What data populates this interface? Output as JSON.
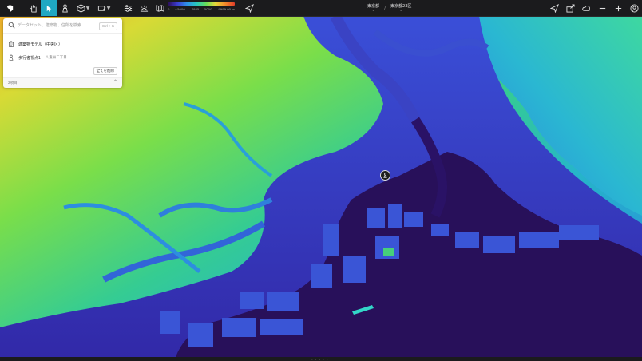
{
  "toolbar": {
    "tools": [
      {
        "name": "logo-icon"
      },
      {
        "name": "hand-icon"
      },
      {
        "name": "cursor-icon",
        "active": true
      },
      {
        "name": "pedestrian-icon"
      },
      {
        "name": "cube-icon"
      },
      {
        "name": "sketch-icon"
      },
      {
        "name": "sliders-icon"
      },
      {
        "name": "sun-icon"
      },
      {
        "name": "map-book-icon"
      }
    ],
    "accent": "#1fa8c2",
    "legend_ticks": [
      "0",
      "+5000",
      "-7935",
      "5000",
      "-9999.00 m"
    ]
  },
  "breadcrumb": {
    "items": [
      "東京都",
      "東京都23区"
    ],
    "separator": "/"
  },
  "right_tools": [
    "send-icon",
    "share-icon",
    "cloud-icon",
    "minus-icon",
    "plus-icon",
    "user-icon"
  ],
  "search": {
    "placeholder": "データセット、建築物、住所を検索",
    "shortcut": "Ctrl + K",
    "items": [
      {
        "icon": "building-icon",
        "name": "建築物モデル（中央区）",
        "sub": ""
      },
      {
        "icon": "pedestrian-icon",
        "name": "歩行者視点1",
        "sub": "八重洲二丁目"
      }
    ],
    "remove_all": "全てを削除",
    "count": "2項目"
  },
  "colors": {
    "low": "#2b0b52",
    "mid": "#2f8fe8",
    "high": "#e6d83a",
    "peak": "#f28a2b"
  }
}
